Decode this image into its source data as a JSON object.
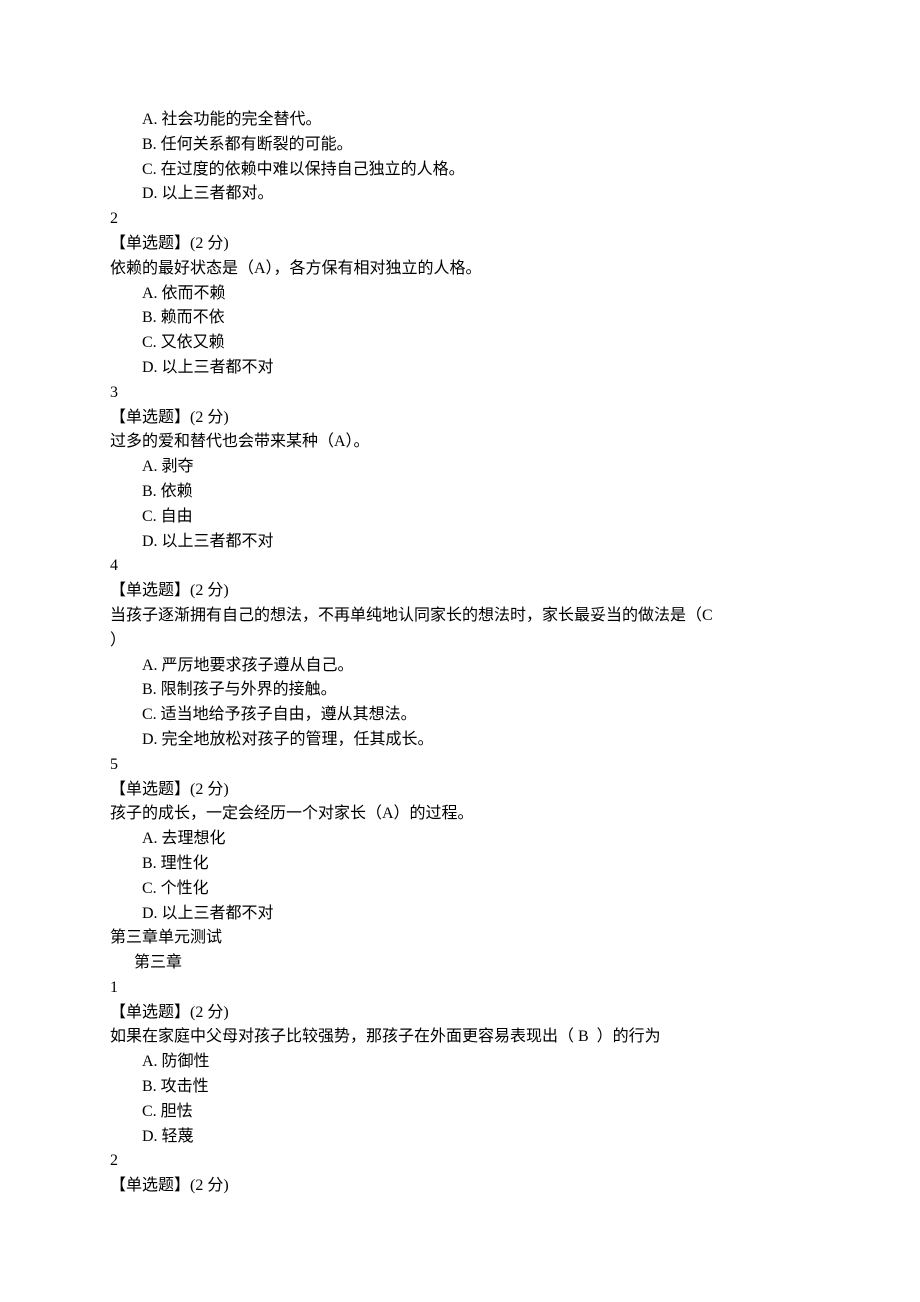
{
  "lines": [
    {
      "cls": "indent-opt",
      "text": "A. 社会功能的完全替代。"
    },
    {
      "cls": "indent-opt",
      "text": "B. 任何关系都有断裂的可能。"
    },
    {
      "cls": "indent-opt",
      "text": "C. 在过度的依赖中难以保持自己独立的人格。"
    },
    {
      "cls": "indent-opt",
      "text": "D. 以上三者都对。"
    },
    {
      "cls": "",
      "text": "2"
    },
    {
      "cls": "",
      "text": "【单选题】(2 分)"
    },
    {
      "cls": "",
      "text": "依赖的最好状态是（A），各方保有相对独立的人格。"
    },
    {
      "cls": "indent-opt",
      "text": "A. 依而不赖"
    },
    {
      "cls": "indent-opt",
      "text": "B. 赖而不依"
    },
    {
      "cls": "indent-opt",
      "text": "C. 又依又赖"
    },
    {
      "cls": "indent-opt",
      "text": "D. 以上三者都不对"
    },
    {
      "cls": "",
      "text": "3"
    },
    {
      "cls": "",
      "text": "【单选题】(2 分)"
    },
    {
      "cls": "",
      "text": "过多的爱和替代也会带来某种（A）。"
    },
    {
      "cls": "indent-opt",
      "text": "A. 剥夺"
    },
    {
      "cls": "indent-opt",
      "text": "B. 依赖"
    },
    {
      "cls": "indent-opt",
      "text": "C. 自由"
    },
    {
      "cls": "indent-opt",
      "text": "D. 以上三者都不对"
    },
    {
      "cls": "",
      "text": "4"
    },
    {
      "cls": "",
      "text": "【单选题】(2 分)"
    },
    {
      "cls": "",
      "text": "当孩子逐渐拥有自己的想法，不再单纯地认同家长的想法时，家长最妥当的做法是（C"
    },
    {
      "cls": "",
      "text": "）"
    },
    {
      "cls": "indent-opt",
      "text": "A. 严厉地要求孩子遵从自己。"
    },
    {
      "cls": "indent-opt",
      "text": "B. 限制孩子与外界的接触。"
    },
    {
      "cls": "indent-opt",
      "text": "C. 适当地给予孩子自由，遵从其想法。"
    },
    {
      "cls": "indent-opt",
      "text": "D. 完全地放松对孩子的管理，任其成长。"
    },
    {
      "cls": "",
      "text": "5"
    },
    {
      "cls": "",
      "text": "【单选题】(2 分)"
    },
    {
      "cls": "",
      "text": "孩子的成长，一定会经历一个对家长（A）的过程。"
    },
    {
      "cls": "indent-opt",
      "text": "A. 去理想化"
    },
    {
      "cls": "indent-opt",
      "text": "B. 理性化"
    },
    {
      "cls": "indent-opt",
      "text": "C. 个性化"
    },
    {
      "cls": "indent-opt",
      "text": "D. 以上三者都不对"
    },
    {
      "cls": "",
      "text": "第三章单元测试"
    },
    {
      "cls": "indent-sub",
      "text": "  第三章"
    },
    {
      "cls": "",
      "text": "1"
    },
    {
      "cls": "",
      "text": "【单选题】(2 分)"
    },
    {
      "cls": "",
      "text": "如果在家庭中父母对孩子比较强势，那孩子在外面更容易表现出（ B  ）的行为"
    },
    {
      "cls": "indent-opt",
      "text": "A. 防御性"
    },
    {
      "cls": "indent-opt",
      "text": "B. 攻击性"
    },
    {
      "cls": "indent-opt",
      "text": "C. 胆怯"
    },
    {
      "cls": "indent-opt",
      "text": "D. 轻蔑"
    },
    {
      "cls": "",
      "text": "2"
    },
    {
      "cls": "",
      "text": "【单选题】(2 分)"
    }
  ]
}
